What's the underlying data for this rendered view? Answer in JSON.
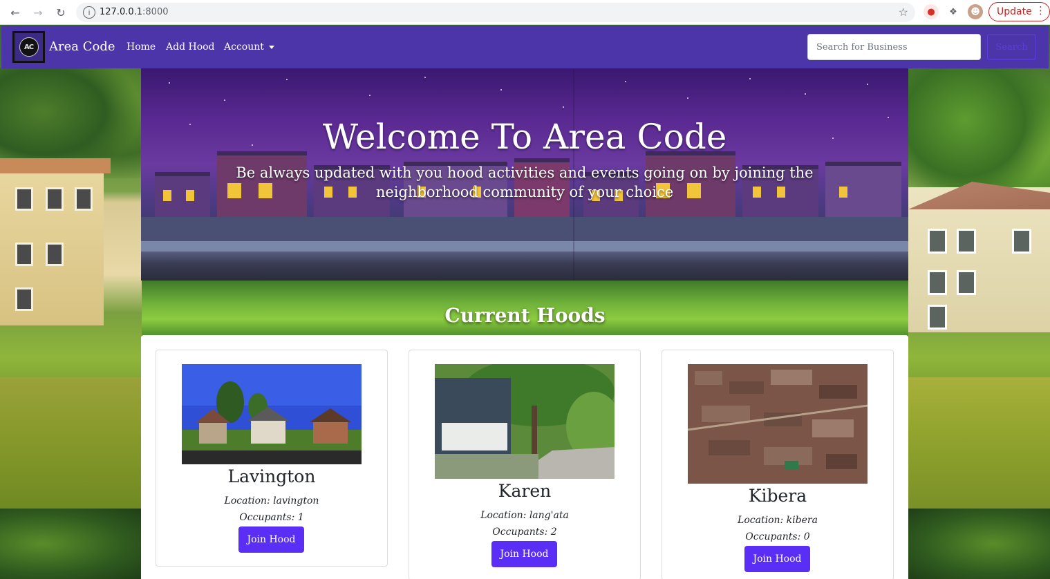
{
  "browser": {
    "url_host": "127.0.0.1",
    "url_port": ":8000",
    "update_label": "Update",
    "back_icon": "arrow-left-icon",
    "forward_icon": "arrow-right-icon",
    "reload_icon": "reload-icon",
    "star_icon": "star-icon"
  },
  "navbar": {
    "logo_text": "AC",
    "brand": "Area Code",
    "links": [
      "Home",
      "Add Hood",
      "Account"
    ],
    "search_placeholder": "Search for Business",
    "search_button": "Search"
  },
  "hero": {
    "title": "Welcome To Area Code",
    "subtitle": "Be always updated with you hood activities and events going on by joining the neighborhood community of your choice"
  },
  "section_title": "Current Hoods",
  "hoods": [
    {
      "name": "Lavington",
      "location": "Location: lavington",
      "occupants": "Occupants: 1",
      "button": "Join Hood"
    },
    {
      "name": "Karen",
      "location": "Location: lang'ata",
      "occupants": "Occupants: 2",
      "button": "Join Hood"
    },
    {
      "name": "Kibera",
      "location": "Location: kibera",
      "occupants": "Occupants: 0",
      "button": "Join Hood"
    }
  ],
  "colors": {
    "navbar": "#4c35a8",
    "button": "#5b2ef5",
    "update": "#c5221f"
  }
}
